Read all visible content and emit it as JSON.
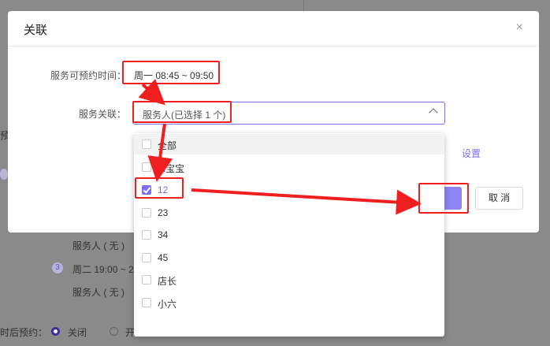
{
  "background": {
    "partial_left": "预",
    "staff_none_1": "服务人 ( 无 )",
    "step_number": "3",
    "slot_2": "周二 19:00 ~ 2",
    "staff_none_2": "服务人 ( 无 )",
    "booking_label": "时后预约：",
    "radio_off": "关闭",
    "radio_on_partial": "开"
  },
  "modal": {
    "title": "关联",
    "close_glyph": "×",
    "time_label": "服务可预约时间：",
    "time_value": "周一 08:45 ~ 09:50",
    "relation_label": "服务关联：",
    "relation_value": "服务人(已选择 1 个)",
    "setting_link": "设置",
    "cancel_label": "取 消"
  },
  "dropdown": {
    "options": [
      {
        "label": "全部",
        "checked": false
      },
      {
        "label": "M宝宝",
        "checked": false
      },
      {
        "label": "12",
        "checked": true
      },
      {
        "label": "23",
        "checked": false
      },
      {
        "label": "34",
        "checked": false
      },
      {
        "label": "45",
        "checked": false
      },
      {
        "label": "店长",
        "checked": false
      },
      {
        "label": "小六",
        "checked": false
      }
    ]
  },
  "colors": {
    "accent": "#7a6ff0",
    "annotation": "#f01f1f"
  }
}
